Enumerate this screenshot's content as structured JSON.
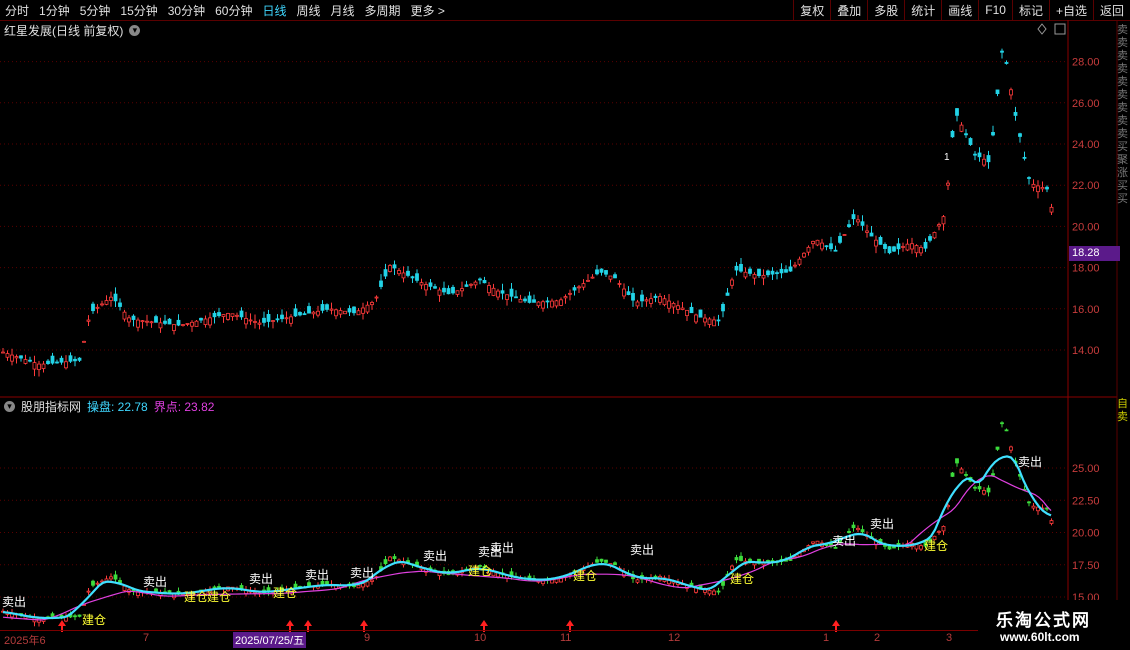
{
  "toolbar": {
    "periods": [
      "分时",
      "1分钟",
      "5分钟",
      "15分钟",
      "30分钟",
      "60分钟",
      "日线",
      "周线",
      "月线",
      "多周期",
      "更多 >"
    ],
    "active_period": "日线",
    "actions": [
      "复权",
      "叠加",
      "多股",
      "统计",
      "画线",
      "F10",
      "标记",
      "+自选",
      "返回"
    ]
  },
  "main_pane": {
    "title": "红星发展(日线 前复权)",
    "price_labels": [
      "28.00",
      "26.00",
      "24.00",
      "22.00",
      "20.00",
      "18.00",
      "16.00",
      "14.00"
    ],
    "current_price": "18.28",
    "marker_text": "1"
  },
  "indicator_pane": {
    "name": "股朋指标网",
    "line1_label": "操盘: 22.78",
    "line2_label": "界点: 23.82",
    "axis_labels": [
      "25.00",
      "22.50",
      "20.00",
      "17.50",
      "15.00"
    ],
    "signals": {
      "sell": "卖出",
      "buy": "建仓"
    }
  },
  "date_axis": {
    "labels": [
      "2025年6",
      "7",
      "2025/07/25/五",
      "9",
      "10",
      "11",
      "12",
      "1",
      "2",
      "3"
    ]
  },
  "side_text": {
    "top_chars": "卖卖卖卖卖卖卖卖卖买聚涨买买",
    "bottom_chars": "自卖"
  },
  "watermark": {
    "title": "乐淘公式网",
    "url": "www.60lt.com"
  },
  "colors": {
    "up": "#ff3b3b",
    "down": "#22d3e6",
    "line1": "#3fe0ff",
    "line2": "#e040e0",
    "sell_label": "#ffffff",
    "buy_label": "#ffff33",
    "grid": "#5a0000"
  }
}
